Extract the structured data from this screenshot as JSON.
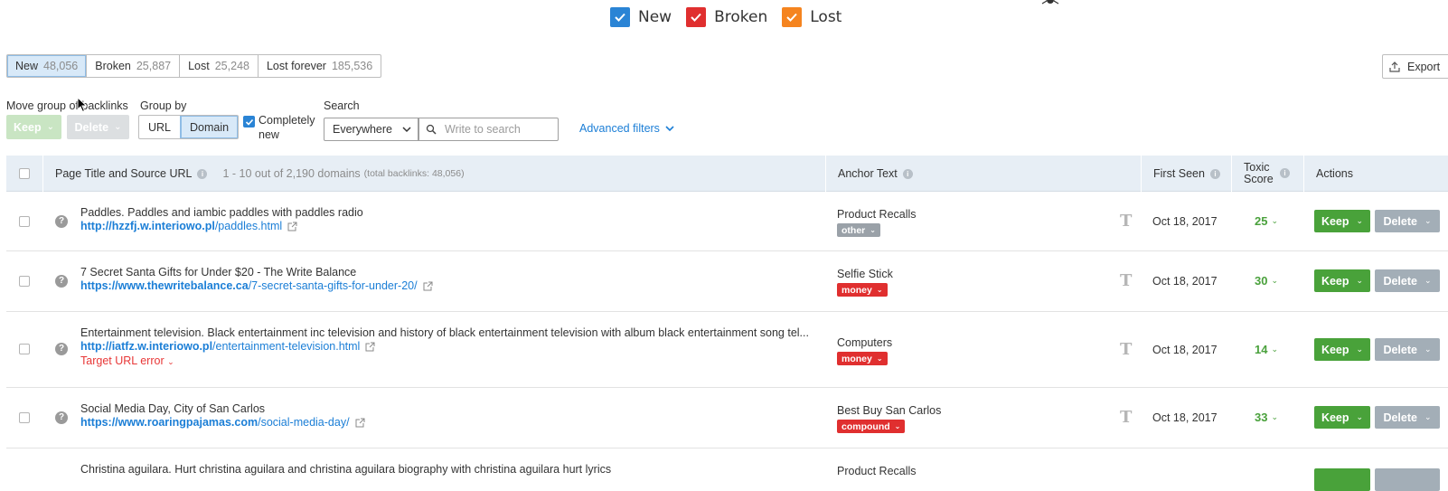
{
  "legend": [
    {
      "label": "New",
      "color": "#2a84d5"
    },
    {
      "label": "Broken",
      "color": "#e02f2f"
    },
    {
      "label": "Lost",
      "color": "#f5841f"
    }
  ],
  "tabs": [
    {
      "label": "New",
      "count": "48,056",
      "active": true
    },
    {
      "label": "Broken",
      "count": "25,887",
      "active": false
    },
    {
      "label": "Lost",
      "count": "25,248",
      "active": false
    },
    {
      "label": "Lost forever",
      "count": "185,536",
      "active": false
    }
  ],
  "export_label": "Export",
  "controls": {
    "move_group_label": "Move group of backlinks",
    "keep_label": "Keep",
    "delete_label": "Delete",
    "group_by_label": "Group by",
    "group_url": "URL",
    "group_domain": "Domain",
    "completely_new_line1": "Completely",
    "completely_new_line2": "new",
    "search_label": "Search",
    "search_scope": "Everywhere",
    "search_placeholder": "Write to search",
    "advanced_filters": "Advanced filters"
  },
  "table": {
    "col_page": "Page Title and Source URL",
    "summary": "1 - 10 out of 2,190 domains",
    "summary_small": "(total backlinks: 48,056)",
    "col_anchor": "Anchor Text",
    "col_first_seen": "First Seen",
    "col_toxic_line1": "Toxic",
    "col_toxic_line2": "Score",
    "col_actions": "Actions",
    "rows": [
      {
        "title": "Paddles. Paddles and iambic paddles with paddles radio",
        "url_domain": "http://hzzfj.w.interiowo.pl",
        "url_path": "/paddles.html",
        "anchor": "Product Recalls",
        "tag": "other",
        "first_seen": "Oct 18, 2017",
        "toxic": "25",
        "error": ""
      },
      {
        "title": "7 Secret Santa Gifts for Under $20 - The Write Balance",
        "url_domain": "https://www.thewritebalance.ca",
        "url_path": "/7-secret-santa-gifts-for-under-20/",
        "anchor": "Selfie Stick",
        "tag": "money",
        "first_seen": "Oct 18, 2017",
        "toxic": "30",
        "error": ""
      },
      {
        "title": "Entertainment television. Black entertainment inc television and history of black entertainment television with album black entertainment song tel...",
        "url_domain": "http://iatfz.w.interiowo.pl",
        "url_path": "/entertainment-television.html",
        "anchor": "Computers",
        "tag": "money",
        "first_seen": "Oct 18, 2017",
        "toxic": "14",
        "error": "Target URL error"
      },
      {
        "title": "Social Media Day, City of San Carlos",
        "url_domain": "https://www.roaringpajamas.com",
        "url_path": "/social-media-day/",
        "anchor": "Best Buy San Carlos",
        "tag": "compound",
        "first_seen": "Oct 18, 2017",
        "toxic": "33",
        "error": ""
      },
      {
        "title": "Christina aguilara. Hurt christina aguilara and christina aguilara biography with christina aguilara hurt lyrics",
        "anchor": "Product Recalls"
      }
    ]
  }
}
